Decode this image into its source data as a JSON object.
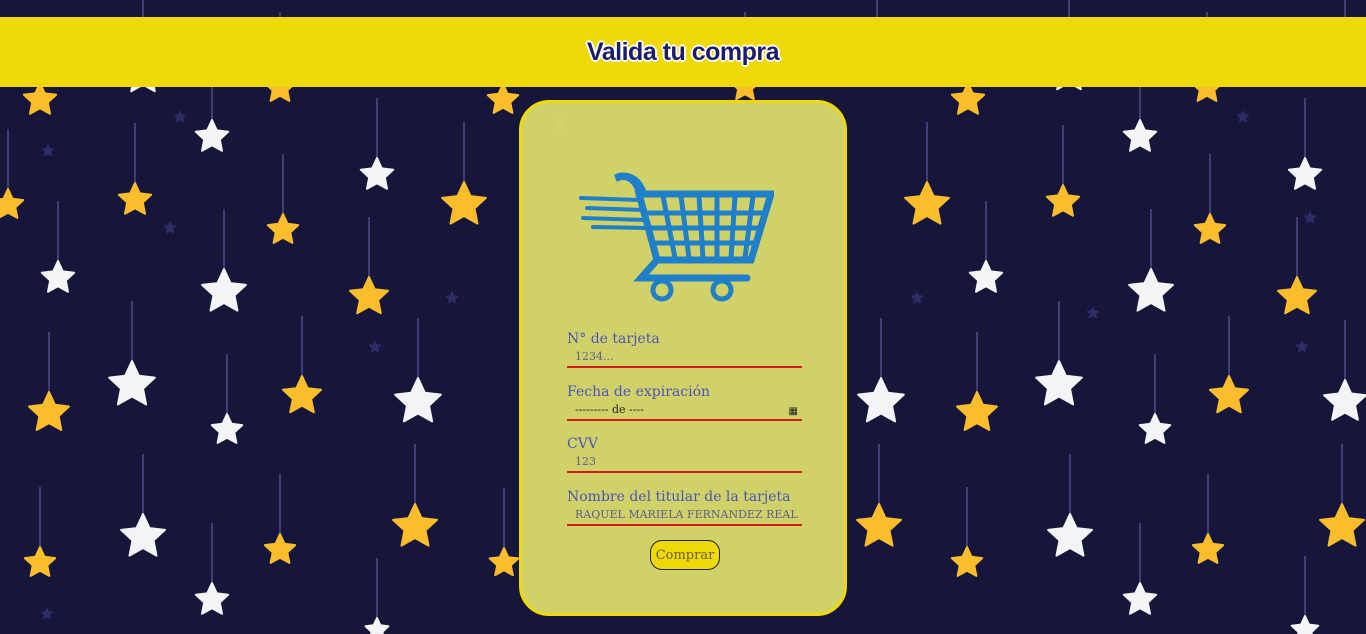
{
  "header": {
    "title": "Valida tu compra"
  },
  "form": {
    "card_number": {
      "label": "N° de tarjeta",
      "placeholder": "1234..."
    },
    "expiration": {
      "label": "Fecha de expiración",
      "value": "--------- de ----"
    },
    "cvv": {
      "label": "CVV",
      "placeholder": "123"
    },
    "holder": {
      "label": "Nombre del titular de la tarjeta",
      "value": "RAQUEL MARIELA FERNANDEZ REAL"
    },
    "submit_label": "Comprar"
  },
  "colors": {
    "background": "#16163a",
    "header": "#efd90a",
    "card": "#ececa0",
    "cart": "#1f7fc8",
    "label": "#4a55b8",
    "underline": "#d21a1a",
    "star_yellow": "#fbbd2b",
    "star_white": "#f4f4f6"
  },
  "icons": [
    "shopping-cart-icon",
    "calendar-icon",
    "star-icon"
  ]
}
